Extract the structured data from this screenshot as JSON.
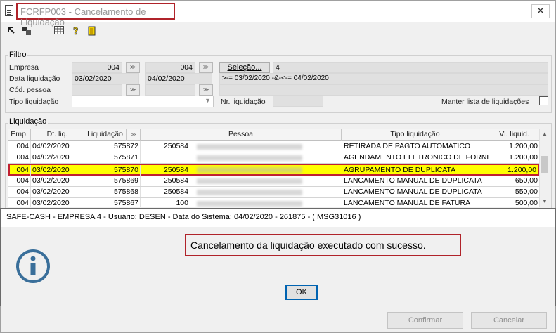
{
  "window": {
    "title": "FCRFP003 - Cancelamento de Liquidação",
    "close_label": "✕"
  },
  "filtro": {
    "group_title": "Filtro",
    "empresa_label": "Empresa",
    "empresa_from": "004",
    "empresa_to": "004",
    "data_label": "Data liquidação",
    "data_from": "03/02/2020",
    "data_to": "04/02/2020",
    "cod_pessoa_label": "Cód. pessoa",
    "tipo_label": "Tipo liquidação",
    "tipo_value": "",
    "nr_label": "Nr. liquidação",
    "nr_value": "",
    "selecao_button": "Seleção...",
    "selecao_count": "4",
    "selecao_expr": ">-= 03/02/2020 -&-<-= 04/02/2020",
    "manter_label": "Manter lista de liquidações"
  },
  "grid": {
    "group_title": "Liquidação",
    "headers": [
      "Emp.",
      "Dt. liq.",
      "Liquidação",
      "",
      "Pessoa",
      "Tipo liquidação",
      "Vl. liquid."
    ],
    "rows": [
      {
        "emp": "004",
        "dt": "04/02/2020",
        "liq": "575872",
        "cod": "250584",
        "tipo": "RETIRADA DE PAGTO AUTOMATICO",
        "valor": "1.200,00"
      },
      {
        "emp": "004",
        "dt": "04/02/2020",
        "liq": "575871",
        "cod": "",
        "tipo": "AGENDAMENTO ELETRONICO DE FORNEC",
        "valor": "1.200,00"
      },
      {
        "emp": "004",
        "dt": "03/02/2020",
        "liq": "575870",
        "cod": "250584",
        "tipo": "AGRUPAMENTO DE DUPLICATA",
        "valor": "1.200,00"
      },
      {
        "emp": "004",
        "dt": "03/02/2020",
        "liq": "575869",
        "cod": "250584",
        "tipo": "LANCAMENTO MANUAL DE DUPLICATA",
        "valor": "650,00"
      },
      {
        "emp": "004",
        "dt": "03/02/2020",
        "liq": "575868",
        "cod": "250584",
        "tipo": "LANCAMENTO MANUAL DE DUPLICATA",
        "valor": "550,00"
      },
      {
        "emp": "004",
        "dt": "03/02/2020",
        "liq": "575867",
        "cod": "100",
        "tipo": "LANCAMENTO MANUAL DE FATURA",
        "valor": "500,00"
      }
    ]
  },
  "dialog": {
    "title": "SAFE-CASH - EMPRESA 4 - Usuário: DESEN - Data do Sistema: 04/02/2020 - 261875 - ( MSG31016 )",
    "message": "Cancelamento da liquidação executado com sucesso.",
    "ok_label": "OK"
  },
  "footer": {
    "confirmar_label": "Confirmar",
    "cancelar_label": "Cancelar"
  },
  "colors": {
    "highlight_row": "#ffff00",
    "annotation_border": "#b0232a",
    "info_icon": "#3a6f9a"
  }
}
